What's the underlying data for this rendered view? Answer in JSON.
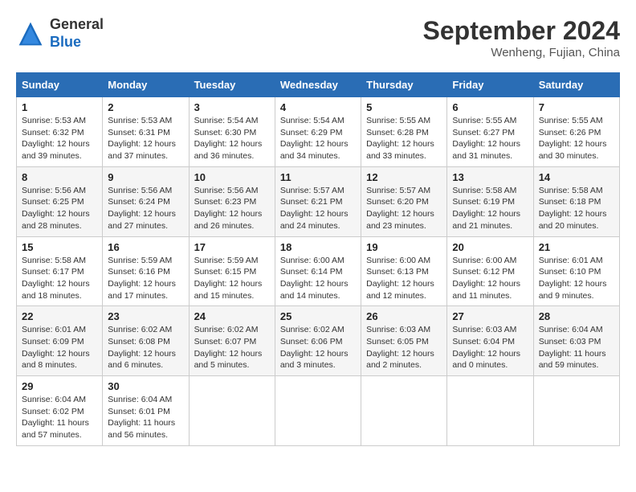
{
  "header": {
    "logo": {
      "general": "General",
      "blue": "Blue"
    },
    "title": "September 2024",
    "subtitle": "Wenheng, Fujian, China"
  },
  "weekdays": [
    "Sunday",
    "Monday",
    "Tuesday",
    "Wednesday",
    "Thursday",
    "Friday",
    "Saturday"
  ],
  "weeks": [
    [
      {
        "day": "1",
        "sunrise": "Sunrise: 5:53 AM",
        "sunset": "Sunset: 6:32 PM",
        "daylight": "Daylight: 12 hours and 39 minutes."
      },
      {
        "day": "2",
        "sunrise": "Sunrise: 5:53 AM",
        "sunset": "Sunset: 6:31 PM",
        "daylight": "Daylight: 12 hours and 37 minutes."
      },
      {
        "day": "3",
        "sunrise": "Sunrise: 5:54 AM",
        "sunset": "Sunset: 6:30 PM",
        "daylight": "Daylight: 12 hours and 36 minutes."
      },
      {
        "day": "4",
        "sunrise": "Sunrise: 5:54 AM",
        "sunset": "Sunset: 6:29 PM",
        "daylight": "Daylight: 12 hours and 34 minutes."
      },
      {
        "day": "5",
        "sunrise": "Sunrise: 5:55 AM",
        "sunset": "Sunset: 6:28 PM",
        "daylight": "Daylight: 12 hours and 33 minutes."
      },
      {
        "day": "6",
        "sunrise": "Sunrise: 5:55 AM",
        "sunset": "Sunset: 6:27 PM",
        "daylight": "Daylight: 12 hours and 31 minutes."
      },
      {
        "day": "7",
        "sunrise": "Sunrise: 5:55 AM",
        "sunset": "Sunset: 6:26 PM",
        "daylight": "Daylight: 12 hours and 30 minutes."
      }
    ],
    [
      {
        "day": "8",
        "sunrise": "Sunrise: 5:56 AM",
        "sunset": "Sunset: 6:25 PM",
        "daylight": "Daylight: 12 hours and 28 minutes."
      },
      {
        "day": "9",
        "sunrise": "Sunrise: 5:56 AM",
        "sunset": "Sunset: 6:24 PM",
        "daylight": "Daylight: 12 hours and 27 minutes."
      },
      {
        "day": "10",
        "sunrise": "Sunrise: 5:56 AM",
        "sunset": "Sunset: 6:23 PM",
        "daylight": "Daylight: 12 hours and 26 minutes."
      },
      {
        "day": "11",
        "sunrise": "Sunrise: 5:57 AM",
        "sunset": "Sunset: 6:21 PM",
        "daylight": "Daylight: 12 hours and 24 minutes."
      },
      {
        "day": "12",
        "sunrise": "Sunrise: 5:57 AM",
        "sunset": "Sunset: 6:20 PM",
        "daylight": "Daylight: 12 hours and 23 minutes."
      },
      {
        "day": "13",
        "sunrise": "Sunrise: 5:58 AM",
        "sunset": "Sunset: 6:19 PM",
        "daylight": "Daylight: 12 hours and 21 minutes."
      },
      {
        "day": "14",
        "sunrise": "Sunrise: 5:58 AM",
        "sunset": "Sunset: 6:18 PM",
        "daylight": "Daylight: 12 hours and 20 minutes."
      }
    ],
    [
      {
        "day": "15",
        "sunrise": "Sunrise: 5:58 AM",
        "sunset": "Sunset: 6:17 PM",
        "daylight": "Daylight: 12 hours and 18 minutes."
      },
      {
        "day": "16",
        "sunrise": "Sunrise: 5:59 AM",
        "sunset": "Sunset: 6:16 PM",
        "daylight": "Daylight: 12 hours and 17 minutes."
      },
      {
        "day": "17",
        "sunrise": "Sunrise: 5:59 AM",
        "sunset": "Sunset: 6:15 PM",
        "daylight": "Daylight: 12 hours and 15 minutes."
      },
      {
        "day": "18",
        "sunrise": "Sunrise: 6:00 AM",
        "sunset": "Sunset: 6:14 PM",
        "daylight": "Daylight: 12 hours and 14 minutes."
      },
      {
        "day": "19",
        "sunrise": "Sunrise: 6:00 AM",
        "sunset": "Sunset: 6:13 PM",
        "daylight": "Daylight: 12 hours and 12 minutes."
      },
      {
        "day": "20",
        "sunrise": "Sunrise: 6:00 AM",
        "sunset": "Sunset: 6:12 PM",
        "daylight": "Daylight: 12 hours and 11 minutes."
      },
      {
        "day": "21",
        "sunrise": "Sunrise: 6:01 AM",
        "sunset": "Sunset: 6:10 PM",
        "daylight": "Daylight: 12 hours and 9 minutes."
      }
    ],
    [
      {
        "day": "22",
        "sunrise": "Sunrise: 6:01 AM",
        "sunset": "Sunset: 6:09 PM",
        "daylight": "Daylight: 12 hours and 8 minutes."
      },
      {
        "day": "23",
        "sunrise": "Sunrise: 6:02 AM",
        "sunset": "Sunset: 6:08 PM",
        "daylight": "Daylight: 12 hours and 6 minutes."
      },
      {
        "day": "24",
        "sunrise": "Sunrise: 6:02 AM",
        "sunset": "Sunset: 6:07 PM",
        "daylight": "Daylight: 12 hours and 5 minutes."
      },
      {
        "day": "25",
        "sunrise": "Sunrise: 6:02 AM",
        "sunset": "Sunset: 6:06 PM",
        "daylight": "Daylight: 12 hours and 3 minutes."
      },
      {
        "day": "26",
        "sunrise": "Sunrise: 6:03 AM",
        "sunset": "Sunset: 6:05 PM",
        "daylight": "Daylight: 12 hours and 2 minutes."
      },
      {
        "day": "27",
        "sunrise": "Sunrise: 6:03 AM",
        "sunset": "Sunset: 6:04 PM",
        "daylight": "Daylight: 12 hours and 0 minutes."
      },
      {
        "day": "28",
        "sunrise": "Sunrise: 6:04 AM",
        "sunset": "Sunset: 6:03 PM",
        "daylight": "Daylight: 11 hours and 59 minutes."
      }
    ],
    [
      {
        "day": "29",
        "sunrise": "Sunrise: 6:04 AM",
        "sunset": "Sunset: 6:02 PM",
        "daylight": "Daylight: 11 hours and 57 minutes."
      },
      {
        "day": "30",
        "sunrise": "Sunrise: 6:04 AM",
        "sunset": "Sunset: 6:01 PM",
        "daylight": "Daylight: 11 hours and 56 minutes."
      },
      null,
      null,
      null,
      null,
      null
    ]
  ]
}
